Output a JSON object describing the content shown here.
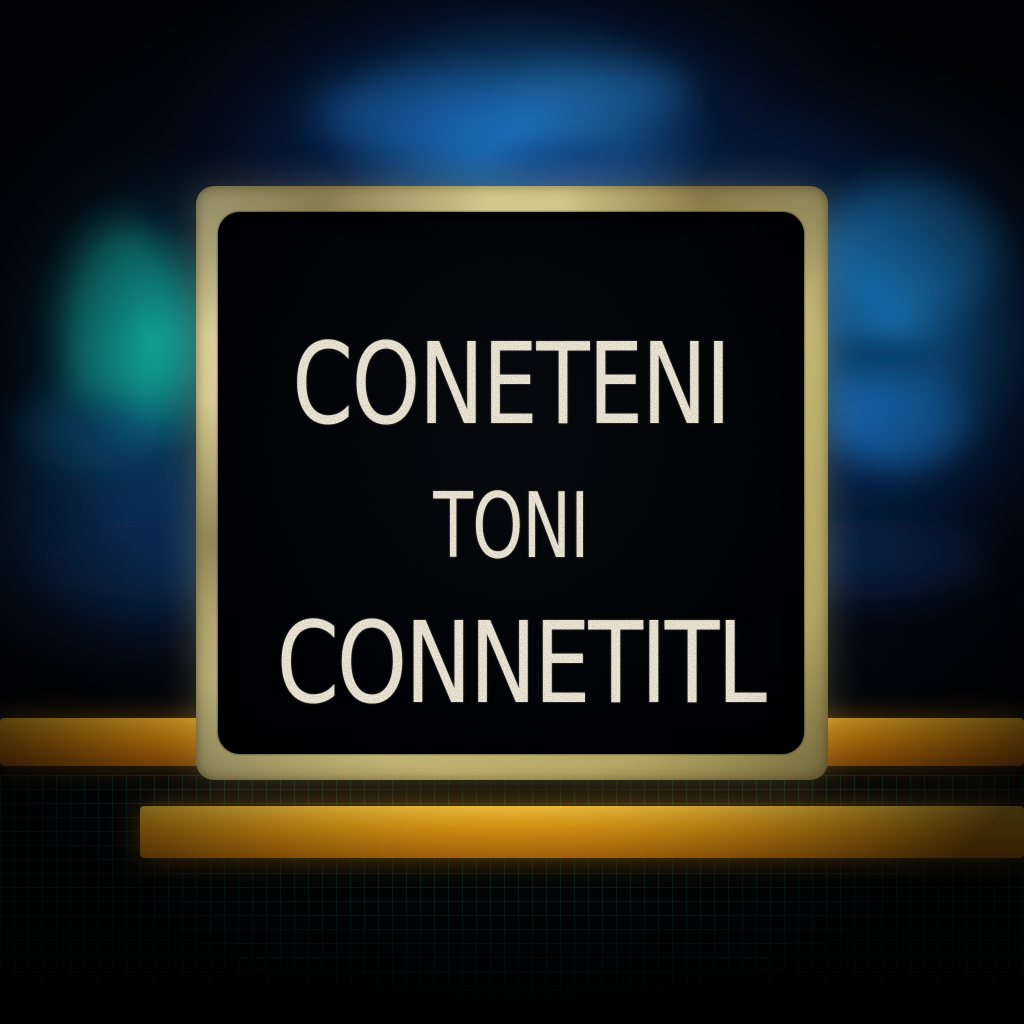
{
  "sign": {
    "line_1": "CONETENI",
    "line_2": "TONI",
    "line_3": "CONNETITL"
  },
  "colors": {
    "frame": "#cfc387",
    "screen": "#020306",
    "text": "#efe9d8",
    "rail": "#f4a817",
    "backdrop_glow": "#2896eb",
    "teal_glow": "#14d2be"
  }
}
